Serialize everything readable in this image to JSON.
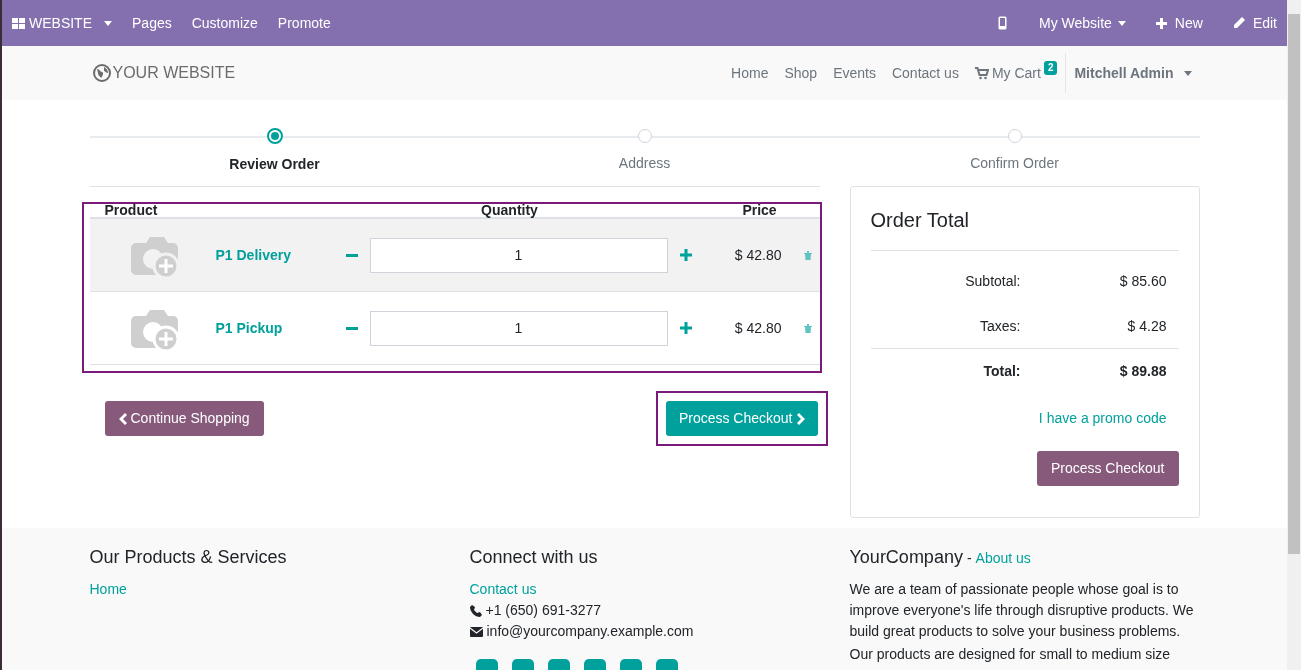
{
  "editor_bar": {
    "app_menu": "WEBSITE",
    "menu": [
      "Pages",
      "Customize",
      "Promote"
    ],
    "website_switcher": "My Website",
    "new_button": "New",
    "edit_button": "Edit"
  },
  "navbar": {
    "logo": "YOUR WEBSITE",
    "links": [
      "Home",
      "Shop",
      "Events",
      "Contact us"
    ],
    "cart": {
      "label": "My Cart",
      "count": "2"
    },
    "user": "Mitchell Admin"
  },
  "steps": [
    {
      "label": "Review Order",
      "selected": true
    },
    {
      "label": "Address",
      "selected": false
    },
    {
      "label": "Confirm Order",
      "selected": false
    }
  ],
  "cart_table": {
    "columns": [
      "Product",
      "Quantity",
      "Price"
    ],
    "rows": [
      {
        "product": "P1 Delivery",
        "quantity": "1",
        "price": "$ 42.80",
        "highlighted": true
      },
      {
        "product": "P1 Pickup",
        "quantity": "1",
        "price": "$ 42.80",
        "highlighted": false
      }
    ]
  },
  "continue_button": "Continue Shopping",
  "checkout_button": "Process Checkout",
  "order_total": {
    "title": "Order Total",
    "lines": [
      {
        "label": "Subtotal:",
        "value": "$ 85.60",
        "kind": "normal"
      },
      {
        "label": "Taxes:",
        "value": "$ 4.28",
        "kind": "normal"
      },
      {
        "label": "Total:",
        "value": "$ 89.88",
        "kind": "total"
      }
    ],
    "promo_link": "I have a promo code",
    "checkout_button": "Process Checkout"
  },
  "footer": {
    "products": {
      "title": "Our Products & Services",
      "links": [
        "Home"
      ]
    },
    "connect": {
      "title": "Connect with us",
      "contact_link": "Contact us",
      "phone": "+1 (650) 691-3277",
      "email": "info@yourcompany.example.com"
    },
    "company": {
      "name": "YourCompany",
      "separator": "-",
      "about_link": "About us",
      "paragraphs": [
        "We are a team of passionate people whose goal is to improve everyone's life through disruptive products. We build great products to solve your business problems.",
        "Our products are designed for small to medium size"
      ]
    }
  }
}
